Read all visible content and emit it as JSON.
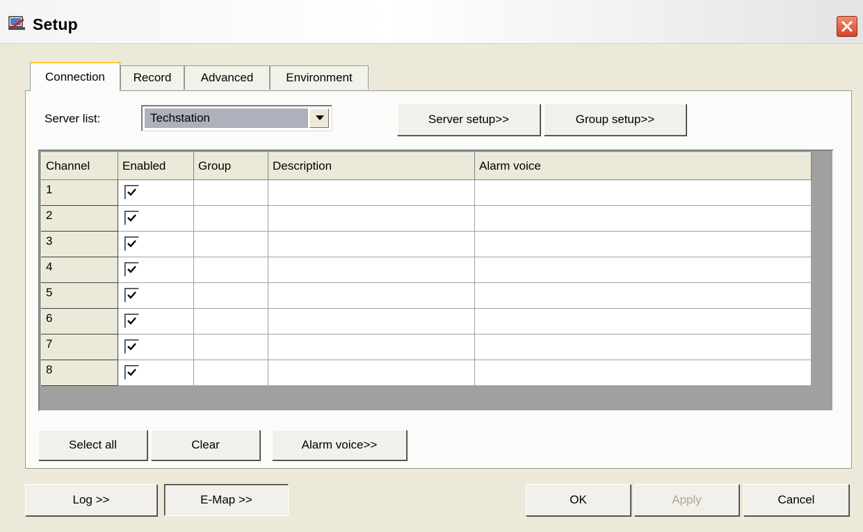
{
  "window": {
    "title": "Setup",
    "close_icon": "close-icon"
  },
  "tabs": [
    {
      "label": "Connection",
      "active": true
    },
    {
      "label": "Record",
      "active": false
    },
    {
      "label": "Advanced",
      "active": false
    },
    {
      "label": "Environment",
      "active": false
    }
  ],
  "server": {
    "label": "Server list:",
    "value": "Techstation"
  },
  "toolbar": {
    "server_setup": "Server setup>>",
    "group_setup": "Group setup>>"
  },
  "grid": {
    "columns": [
      "Channel",
      "Enabled",
      "Group",
      "Description",
      "Alarm voice"
    ],
    "rows": [
      {
        "channel": "1",
        "enabled": true,
        "group": "",
        "description": "",
        "alarm_voice": ""
      },
      {
        "channel": "2",
        "enabled": true,
        "group": "",
        "description": "",
        "alarm_voice": ""
      },
      {
        "channel": "3",
        "enabled": true,
        "group": "",
        "description": "",
        "alarm_voice": ""
      },
      {
        "channel": "4",
        "enabled": true,
        "group": "",
        "description": "",
        "alarm_voice": ""
      },
      {
        "channel": "5",
        "enabled": true,
        "group": "",
        "description": "",
        "alarm_voice": ""
      },
      {
        "channel": "6",
        "enabled": true,
        "group": "",
        "description": "",
        "alarm_voice": ""
      },
      {
        "channel": "7",
        "enabled": true,
        "group": "",
        "description": "",
        "alarm_voice": ""
      },
      {
        "channel": "8",
        "enabled": true,
        "group": "",
        "description": "",
        "alarm_voice": ""
      }
    ]
  },
  "panel_buttons": {
    "select_all": "Select all",
    "clear": "Clear",
    "alarm_voice": "Alarm voice>>"
  },
  "footer": {
    "log": "Log >>",
    "emap": "E-Map >>",
    "ok": "OK",
    "apply": "Apply",
    "cancel": "Cancel"
  },
  "colors": {
    "accent_tab": "#ffc83c",
    "close_button": "#d6452a",
    "selection": "#aeb0bc"
  }
}
